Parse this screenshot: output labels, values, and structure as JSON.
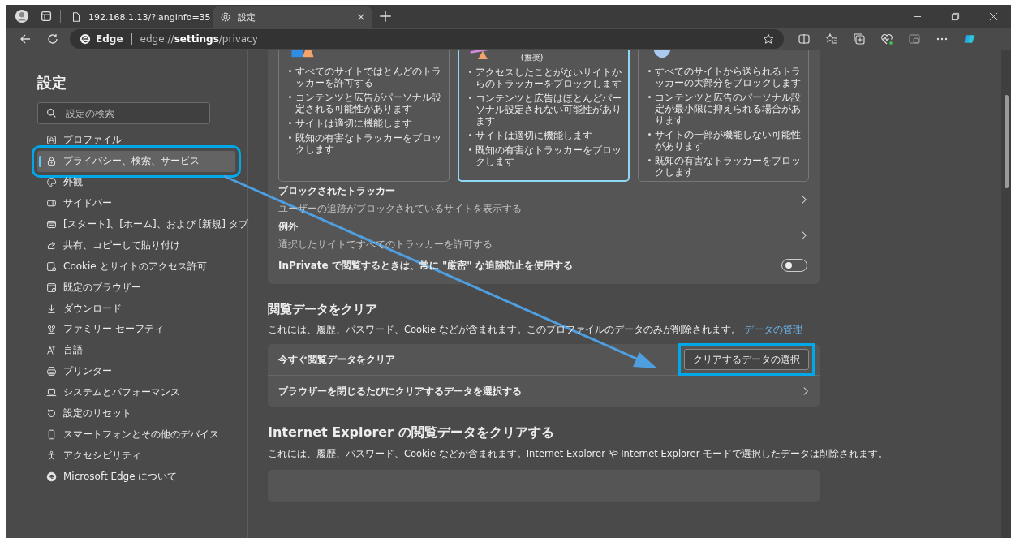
{
  "browser": {
    "tabs": [
      {
        "title": "192.168.1.13/?langinfo=35",
        "selected": false,
        "kind": "page"
      },
      {
        "title": "設定",
        "selected": true,
        "kind": "settings"
      }
    ],
    "address": {
      "brand": "Edge",
      "url": "edge://**settings**/privacy"
    }
  },
  "sidebar": {
    "title": "設定",
    "search": {
      "placeholder": "設定の検索"
    },
    "items": [
      {
        "label": "プロファイル",
        "selected": false,
        "highlighted": false
      },
      {
        "label": "プライバシー、検索、サービス",
        "selected": true,
        "highlighted": true
      },
      {
        "label": "外観",
        "selected": false,
        "highlighted": false
      },
      {
        "label": "サイドバー",
        "selected": false,
        "highlighted": false
      },
      {
        "label": "[スタート]、[ホーム]、および [新規] タブ",
        "selected": false,
        "highlighted": false
      },
      {
        "label": "共有、コピーして貼り付け",
        "selected": false,
        "highlighted": false
      },
      {
        "label": "Cookie とサイトのアクセス許可",
        "selected": false,
        "highlighted": false
      },
      {
        "label": "既定のブラウザー",
        "selected": false,
        "highlighted": false
      },
      {
        "label": "ダウンロード",
        "selected": false,
        "highlighted": false
      },
      {
        "label": "ファミリー セーフティ",
        "selected": false,
        "highlighted": false
      },
      {
        "label": "言語",
        "selected": false,
        "highlighted": false
      },
      {
        "label": "プリンター",
        "selected": false,
        "highlighted": false
      },
      {
        "label": "システムとパフォーマンス",
        "selected": false,
        "highlighted": false
      },
      {
        "label": "設定のリセット",
        "selected": false,
        "highlighted": false
      },
      {
        "label": "スマートフォンとその他のデバイス",
        "selected": false,
        "highlighted": false
      },
      {
        "label": "アクセシビリティ",
        "selected": false,
        "highlighted": false
      },
      {
        "label": "Microsoft Edge について",
        "selected": false,
        "highlighted": false
      }
    ]
  },
  "tracking_levels": [
    {
      "selected": false,
      "bullets": [
        "すべてのサイトではとんどのトラッカーを許可する",
        "コンテンツと広告がパーソナル設定される可能性があります",
        "サイトは適切に機能します",
        "既知の有害なトラッカーをブロックします"
      ]
    },
    {
      "selected": true,
      "note": "(推奨)",
      "bullets": [
        "アクセスしたことがないサイトからのトラッカーをブロックします",
        "コンテンツと広告はほとんどパーソナル設定されない可能性があります",
        "サイトは適切に機能します",
        "既知の有害なトラッカーをブロックします"
      ]
    },
    {
      "selected": false,
      "bullets": [
        "すべてのサイトから送られるトラッカーの大部分をブロックします",
        "コンテンツと広告のパーソナル設定が最小限に抑えられる場合があります",
        "サイトの一部が機能しない可能性があります",
        "既知の有害なトラッカーをブロックします"
      ]
    }
  ],
  "tracking_rows": [
    {
      "kind": "link",
      "title": "ブロックされたトラッカー",
      "description": "ユーザーの追跡がブロックされているサイトを表示する"
    },
    {
      "kind": "link",
      "title": "例外",
      "description": "選択したサイトですべてのトラッカーを許可する"
    },
    {
      "kind": "toggle",
      "title": "InPrivate で閲覧するときは、常に \"厳密\" な追跡防止を使用する",
      "on": false
    }
  ],
  "clear_data": {
    "heading": "閲覧データをクリア",
    "description": "これには、履歴、パスワード、Cookie などが含まれます。このプロファイルのデータのみが削除されます。",
    "link": "データの管理",
    "rows": [
      {
        "kind": "button",
        "label": "今すぐ閲覧データをクリア",
        "button": "クリアするデータの選択",
        "highlighted": true
      },
      {
        "kind": "link",
        "label": "ブラウザーを閉じるたびにクリアするデータを選択する"
      }
    ]
  },
  "ie_data": {
    "heading": "Internet Explorer の閲覧データをクリアする",
    "description": "これには、履歴、パスワード、Cookie などが含まれます。Internet Explorer や Internet Explorer モードで選択したデータは削除されます。"
  }
}
